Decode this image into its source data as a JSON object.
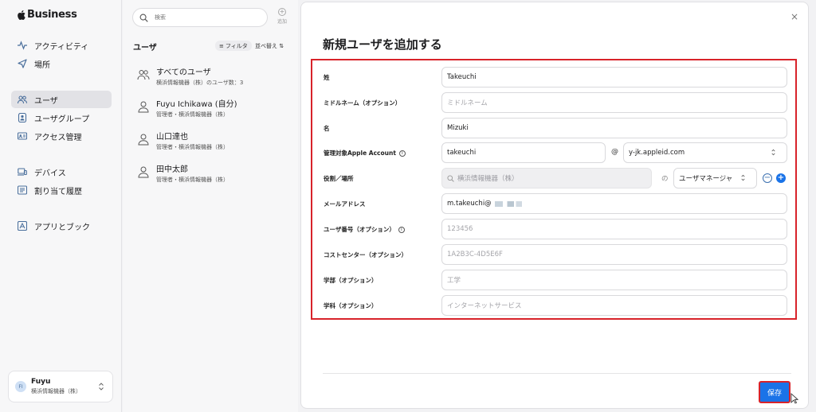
{
  "brand": {
    "name": "Business"
  },
  "sidebar": {
    "items": [
      {
        "label": "アクティビティ",
        "icon": "activity-icon"
      },
      {
        "label": "場所",
        "icon": "location-icon"
      },
      {
        "label": "ユーザ",
        "icon": "users-icon",
        "active": true
      },
      {
        "label": "ユーザグループ",
        "icon": "user-group-icon"
      },
      {
        "label": "アクセス管理",
        "icon": "access-icon"
      },
      {
        "label": "デバイス",
        "icon": "device-icon"
      },
      {
        "label": "割り当て履歴",
        "icon": "history-icon"
      },
      {
        "label": "アプリとブック",
        "icon": "apps-icon"
      }
    ],
    "account": {
      "initials": "FI",
      "name": "Fuyu",
      "org": "横浜情報機器（株）"
    }
  },
  "list": {
    "search_placeholder": "検索",
    "add_label": "追加",
    "title": "ユーザ",
    "filter_label": "フィルタ",
    "sort_label": "並べ替え ⇅",
    "rows": [
      {
        "name": "すべてのユーザ",
        "sub": "横浜情報機器（株）のユーザ数：3"
      },
      {
        "name": "Fuyu Ichikawa (自分)",
        "sub": "管理者・横浜情報機器（株）"
      },
      {
        "name": "山口達也",
        "sub": "管理者・横浜情報機器（株）"
      },
      {
        "name": "田中太郎",
        "sub": "管理者・横浜情報機器（株）"
      }
    ]
  },
  "dialog": {
    "title": "新規ユーザを追加する",
    "fields": {
      "last_name": {
        "label": "姓",
        "value": "Takeuchi"
      },
      "middle_name": {
        "label": "ミドルネーム（オプション）",
        "placeholder": "ミドルネーム"
      },
      "first_name": {
        "label": "名",
        "value": "Mizuki"
      },
      "apple_account": {
        "label": "管理対象Apple Account",
        "value": "takeuchi",
        "at": "@",
        "domain": "y-jk.appleid.com"
      },
      "role": {
        "label": "役割／場所",
        "location_placeholder": "横浜情報機器（株）",
        "of": "の",
        "role_value": "ユーザマネージャ"
      },
      "email": {
        "label": "メールアドレス",
        "value": "m.takeuchi@"
      },
      "user_number": {
        "label": "ユーザ番号（オプション）",
        "placeholder": "123456"
      },
      "cost_center": {
        "label": "コストセンター（オプション）",
        "placeholder": "1A2B3C-4D5E6F"
      },
      "division": {
        "label": "学部（オプション）",
        "placeholder": "工学"
      },
      "department": {
        "label": "学科（オプション）",
        "placeholder": "インターネットサービス"
      }
    },
    "save_label": "保存",
    "close_label": "×"
  },
  "colors": {
    "accent": "#1a73e8",
    "highlight": "#d8232a"
  }
}
